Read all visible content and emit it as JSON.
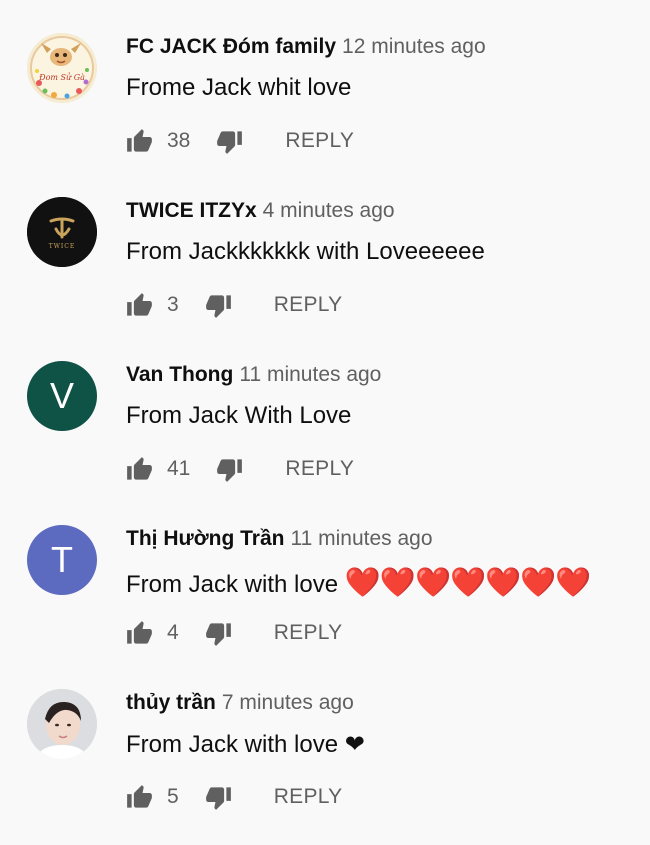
{
  "comments": [
    {
      "author": "FC JACK Đóm family",
      "time": "12 minutes ago",
      "text": "Frome Jack whit love",
      "likes": "38",
      "reply_label": "REPLY",
      "avatar": {
        "type": "image",
        "text": "Đom Sử Gà",
        "bg": "#f3e7c9"
      }
    },
    {
      "author": "TWICE ITZYx",
      "time": "4 minutes ago",
      "text": "From Jackkkkkkk with Loveeeeee",
      "likes": "3",
      "reply_label": "REPLY",
      "avatar": {
        "type": "logo",
        "text": "TWICE",
        "bg": "#111111"
      }
    },
    {
      "author": "Van Thong",
      "time": "11 minutes ago",
      "text": "From Jack With Love",
      "likes": "41",
      "reply_label": "REPLY",
      "avatar": {
        "type": "letter",
        "letter": "V",
        "bg": "#0f5246"
      }
    },
    {
      "author": "Thị Hường Trần",
      "time": "11 minutes ago",
      "text": "From Jack with love",
      "emoji": "❤️❤️❤️❤️❤️❤️❤️",
      "likes": "4",
      "reply_label": "REPLY",
      "avatar": {
        "type": "letter",
        "letter": "T",
        "bg": "#5c6bc0"
      }
    },
    {
      "author": "thủy trần",
      "time": "7 minutes ago",
      "text": "From Jack with love",
      "emoji": "❤",
      "likes": "5",
      "reply_label": "REPLY",
      "avatar": {
        "type": "photo",
        "bg": "#d9dadc"
      }
    }
  ],
  "colors": {
    "author": "#0f0f0f",
    "secondary": "#606060",
    "heart": "#d5001c"
  },
  "icons": {
    "like": "thumb-up-icon",
    "dislike": "thumb-down-icon"
  }
}
